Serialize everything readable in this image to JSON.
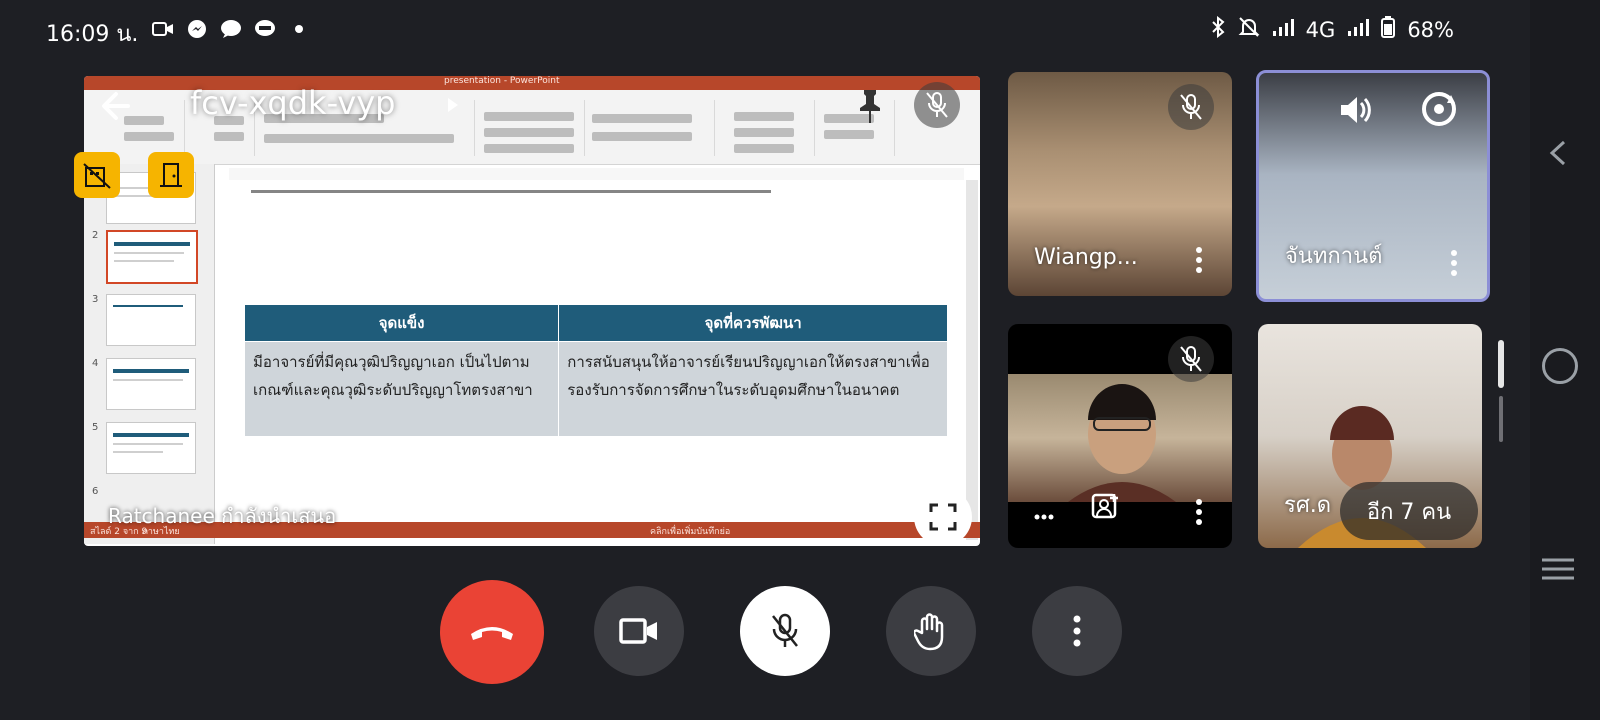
{
  "status_bar": {
    "time": "16:09 น.",
    "network": "4G",
    "battery": "68%"
  },
  "presentation": {
    "meeting_code": "fcv-xqdk-vyp",
    "presenter_label": "Ratchanee กำลังนำเสนอ",
    "app_title": "presentation - PowerPoint",
    "slide_status": "สไลด์ 2 จาก 9",
    "slide_language": "ภาษาไทย",
    "notes_hint": "คลิกเพื่อเพิ่มบันทึกย่อ",
    "thumb_numbers": [
      "2",
      "3",
      "4",
      "5",
      "6"
    ],
    "table": {
      "headers": [
        "จุดแข็ง",
        "จุดที่ควรพัฒนา"
      ],
      "rows": [
        [
          "มีอาจารย์ที่มีคุณวุฒิปริญญาเอก เป็นไปตามเกณฑ์และคุณวุฒิระดับปริญญาโทตรงสาขา",
          "การสนับสนุนให้อาจารย์เรียนปริญญาเอกให้ตรงสาขาเพื่อรองรับการจัดการศึกษาในระดับอุดมศึกษาในอนาคต"
        ]
      ]
    }
  },
  "participants": [
    {
      "name": "Wiangp...",
      "muted": true
    },
    {
      "name": "จันทกานต์",
      "muted": false
    },
    {
      "name": "",
      "muted": true
    },
    {
      "name": "รศ.ด",
      "muted": false
    }
  ],
  "more_people": "อีก 7 คน",
  "colors": {
    "end_call": "#ea4335",
    "ppt_red": "#b7472a",
    "table_header": "#1f5c7a",
    "badge_yellow": "#f6b400"
  }
}
